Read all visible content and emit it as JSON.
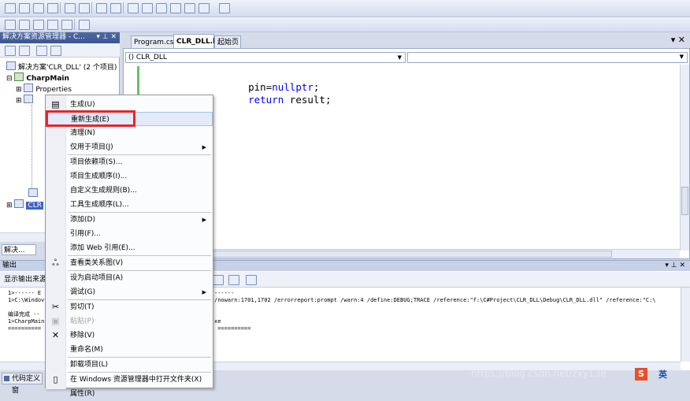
{
  "solution_explorer": {
    "title": "解决方案资源管理器 - C...",
    "pin": "▾ ⊥ ✕",
    "solution_label": "解决方案'CLR_DLL' (2 个项目)",
    "project_label": "CharpMain",
    "properties_label": "Properties",
    "item_partial": "CLR",
    "bottom_tab": "解决..."
  },
  "editor": {
    "tabs": [
      {
        "label": "Program.cs"
      },
      {
        "label": "CLR_DLL.h"
      },
      {
        "label": "起始页"
      }
    ],
    "close": "▾ ✕",
    "scope_dropdown": "() CLR_DLL",
    "code": {
      "line1_ident": "pin",
      "line1_op": "=",
      "line1_kw": "nullptr",
      "line1_end": ";",
      "line2_kw": "return",
      "line2_rest": " result;"
    }
  },
  "output": {
    "title": "输出",
    "title_btns": "▾ ⊥ ✕",
    "source_label": "显示输出来源",
    "lines_left": [
      "1>------ E",
      "1>C:\\Windov",
      "",
      "编译完成 --",
      "1>CharpMain",
      "=========="
    ],
    "lines_right": [
      "------",
      "/nowarn:1701,1702 /errorreport:prompt /warn:4 /define:DEBUG;TRACE /reference:\"f:\\C#Project\\CLR_DLL\\Debug\\CLR_DLL.dll\" /reference:\"C:\\",
      "",
      "",
      "xe",
      " =========="
    ]
  },
  "bottom": {
    "left_tab": "代码定义窗",
    "watermark": "https://blog.csdn.net/zxy138",
    "ime": "英"
  },
  "context_menu": {
    "items": [
      {
        "label": "生成(U)",
        "icon": "build-icon"
      },
      {
        "label": "重新生成(E)",
        "icon": ""
      },
      {
        "label": "清理(N)",
        "icon": ""
      },
      {
        "label": "仅用于项目(J)",
        "icon": "",
        "submenu": true
      },
      {
        "label": "项目依赖项(S)...",
        "icon": ""
      },
      {
        "label": "项目生成顺序(I)...",
        "icon": ""
      },
      {
        "label": "自定义生成规则(B)...",
        "icon": ""
      },
      {
        "label": "工具生成顺序(L)...",
        "icon": ""
      },
      {
        "label": "添加(D)",
        "icon": "",
        "submenu": true
      },
      {
        "label": "引用(F)...",
        "icon": ""
      },
      {
        "label": "添加 Web 引用(E)...",
        "icon": ""
      },
      {
        "label": "查看类关系图(V)",
        "icon": "class-diagram-icon"
      },
      {
        "label": "设为启动项目(A)",
        "icon": ""
      },
      {
        "label": "调试(G)",
        "icon": "",
        "submenu": true
      },
      {
        "label": "剪切(T)",
        "icon": "cut-icon"
      },
      {
        "label": "粘贴(P)",
        "icon": "paste-icon",
        "disabled": true
      },
      {
        "label": "移除(V)",
        "icon": "remove-icon"
      },
      {
        "label": "重命名(M)",
        "icon": ""
      },
      {
        "label": "卸载项目(L)",
        "icon": ""
      },
      {
        "label": "在 Windows 资源管理器中打开文件夹(X)",
        "icon": "folder-icon"
      },
      {
        "label": "属性(R)",
        "icon": ""
      }
    ],
    "highlight_color": "#e8242b"
  }
}
